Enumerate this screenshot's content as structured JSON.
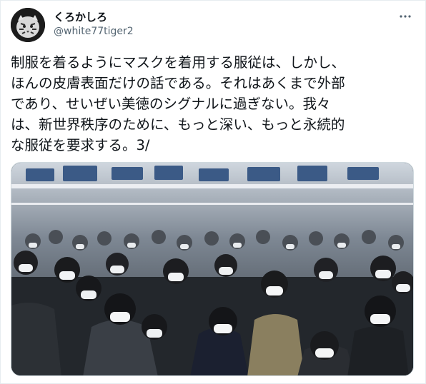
{
  "tweet": {
    "display_name": "くろかしろ",
    "handle": "@white77tiger2",
    "text": "制服を着るようにマスクを着用する服従は、しかし、\nほんの皮膚表面だけの話である。それはあくまで外部\nであり、せいぜい美徳のシグナルに過ぎない。我々\nは、新世界秩序のために、もっと深い、もっと永続的\nな服従を要求する。3/"
  },
  "icons": {
    "avatar": "tiger-avatar",
    "more": "more-options-icon"
  },
  "colors": {
    "text": "#0f1419",
    "secondary": "#536471",
    "border": "#cfd9de"
  }
}
